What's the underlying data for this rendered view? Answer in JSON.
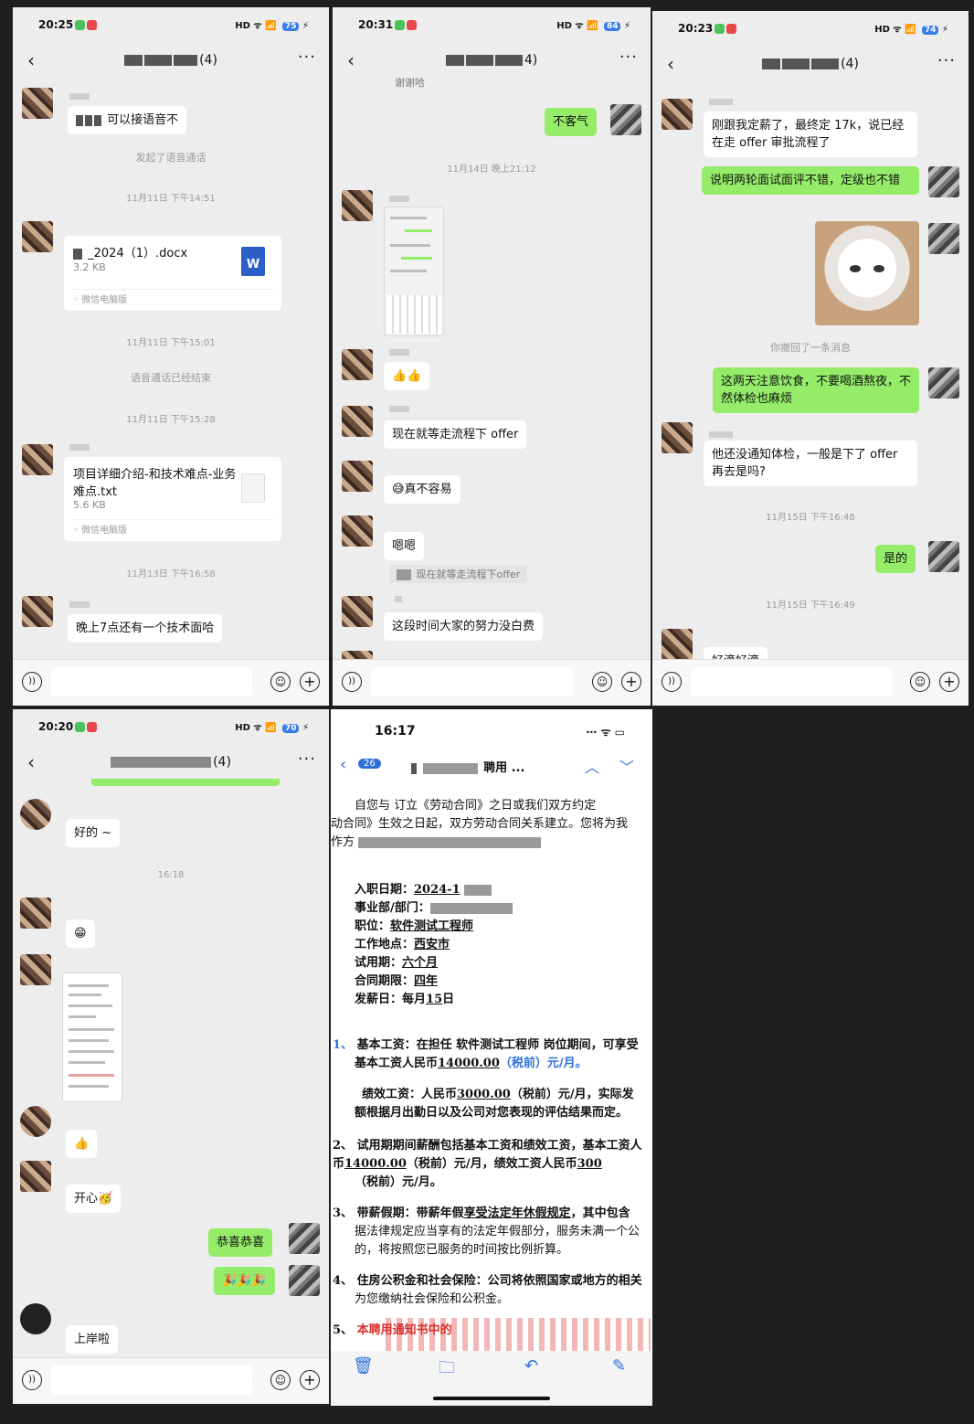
{
  "panel1": {
    "status": {
      "time": "20:25",
      "battery": "75"
    },
    "header": {
      "count": "(4)"
    },
    "messages": {
      "voice_invite": "可以接语音不",
      "voice_started": "发起了语音通话",
      "ts1": "11月11日 下午14:51",
      "file1_name": "_2024（1）.docx",
      "file1_size": "3.2 KB",
      "file1_source": "微信电脑版",
      "file1_icon": "W",
      "ts2": "11月11日 下午15:01",
      "voice_ended": "语音通话已经结束",
      "ts3": "11月11日 下午15:28",
      "file2_name": "项目详细介绍-和技术难点-业务难点.txt",
      "file2_size": "5.6 KB",
      "file2_source": "微信电脑版",
      "ts4": "11月13日 下午16:58",
      "interview": "晚上7点还有一个技术面哈"
    }
  },
  "panel2": {
    "status": {
      "time": "20:31",
      "battery": "84"
    },
    "header": {
      "count": "4)"
    },
    "messages": {
      "top_cut": "谢谢哈",
      "youre_welcome": "不客气",
      "ts1": "11月14日 晚上21:12",
      "thumbs": "👍👍",
      "waiting_offer": "现在就等走流程下 offer",
      "not_easy": "😅真不容易",
      "ok": "嗯嗯",
      "quote": "现在就等走流程下offer",
      "effort": "这段时间大家的努力没白费"
    }
  },
  "panel3": {
    "status": {
      "time": "20:23",
      "battery": "74"
    },
    "header": {
      "count": "(4)"
    },
    "messages": {
      "salary": "刚跟我定薪了，最终定 17k，说已经在走 offer 审批流程了",
      "reviews": "说明两轮面试面评不错，定级也不错",
      "recalled": "你撤回了一条消息",
      "health": "这两天注意饮食，不要喝酒熬夜，不然体检也麻烦",
      "question": "他还没通知体检，一般是下了 offer 再去是吗?",
      "ts1": "11月15日 下午16:48",
      "yes": "是的",
      "ts2": "11月15日 下午16:49",
      "fine": "好滴好滴"
    }
  },
  "panel4": {
    "status": {
      "time": "20:20",
      "battery": "70"
    },
    "header": {
      "count": "(4)"
    },
    "messages": {
      "good": "好的 ~",
      "ts1": "16:18",
      "grin": "😁",
      "thumb": "👍",
      "happy": "开心🥳",
      "congrats": "恭喜恭喜",
      "party": "🎉🎉🎉",
      "landed": "上岸啦"
    }
  },
  "panel5": {
    "status": {
      "time": "16:17"
    },
    "nav": {
      "count": "26",
      "title_suffix": "聘用 ..."
    },
    "letter": {
      "intro1": "自您与        订立《劳动合同》之日或我们双方约定",
      "intro2": "动合同》生效之日起，双方劳动合同关系建立。您将为我",
      "intro3": "作方",
      "entry_label": "入职日期：",
      "entry_value": "2024-1",
      "dept_label": "事业部/部门：",
      "position_label": "职位：",
      "position_value": "软件测试工程师",
      "location_label": "工作地点：",
      "location_value": "西安市",
      "probation_label": "试用期：",
      "probation_value": "六个月",
      "term_label": "合同期限：",
      "term_value": "四年",
      "payday_label": "发薪日：",
      "payday_value": "每月",
      "payday_day": "15",
      "payday_unit": "日",
      "c1_num": "1、",
      "c1_a": "基本工资：在担任 软件测试工程师 岗位期间，可享受",
      "c1_b": "基本工资人民币",
      "c1_amt": "14000.00",
      "c1_c": "（税前）元/月。",
      "c1_perf_a": "绩效工资：人民币",
      "c1_perf_amt": "3000.00",
      "c1_perf_b": "（税前）元/月，实际发",
      "c1_perf_c": "额根据月出勤日以及公司对您表现的评估结果而定。",
      "c2_num": "2、",
      "c2_a": "试用期期间薪酬包括基本工资和绩效工资，基本工资人",
      "c2_b": "币",
      "c2_amt": "14000.00",
      "c2_c": "（税前）元/月，绩效工资人民币",
      "c2_d": "300",
      "c2_e": "（税前）元/月。",
      "c3_num": "3、",
      "c3_a": "带薪假期：带薪年假",
      "c3_b": "享受法定年休假规定",
      "c3_c": "，其中包含",
      "c3_d": "据法律规定应当享有的法定年假部分，服务未满一个公",
      "c3_e": "的，将按照您已服务的时间按比例折算。",
      "c4_num": "4、",
      "c4_a": "住房公积金和社会保险：公司将依照国家或地方的相关",
      "c4_b": "为您缴纳社会保险和公积金。",
      "c5_num": "5、",
      "c5_a": "本聘用通知书中的"
    }
  },
  "colors": {
    "bubble_green": "#95ec69",
    "accent_blue": "#2f6fd8"
  }
}
